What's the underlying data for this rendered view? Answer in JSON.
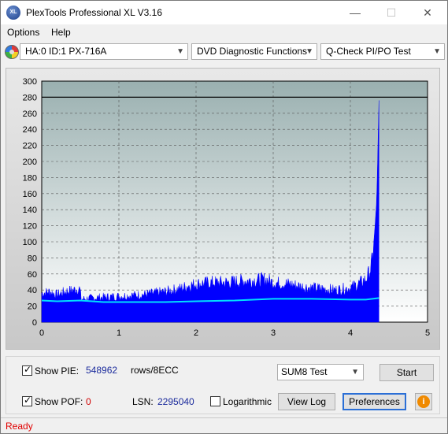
{
  "window": {
    "title": "PlexTools Professional XL V3.16",
    "icon_text": "XL"
  },
  "titlebar_buttons": {
    "minimize": "—",
    "maximize": "☐",
    "close": "✕"
  },
  "menu": [
    {
      "label": "Options"
    },
    {
      "label": "Help"
    }
  ],
  "toolbar": {
    "drive": "HA:0 ID:1  PX-716A",
    "function": "DVD Diagnostic Functions",
    "test": "Q-Check PI/PO Test"
  },
  "controls": {
    "show_pie": {
      "label": "Show PIE:",
      "checked": true,
      "value": "548962",
      "unit": "rows/8ECC"
    },
    "show_pof": {
      "label": "Show POF:",
      "checked": true,
      "value": "0"
    },
    "lsn": {
      "label": "LSN:",
      "value": "2295040"
    },
    "logarithmic": {
      "label": "Logarithmic",
      "checked": false
    },
    "test_select": "SUM8 Test",
    "start_button": "Start",
    "view_log_button": "View Log",
    "preferences_button": "Preferences",
    "info_icon": "i"
  },
  "status": {
    "text": "Ready"
  },
  "chart_data": {
    "type": "area",
    "x_ticks": [
      0,
      1,
      2,
      3,
      4,
      5
    ],
    "y_ticks": [
      0,
      20,
      40,
      60,
      80,
      100,
      120,
      140,
      160,
      180,
      200,
      220,
      240,
      260,
      280,
      300
    ],
    "xlim": [
      0,
      5
    ],
    "ylim": [
      0,
      300
    ],
    "threshold": 280,
    "grid": true,
    "colors": {
      "pie": "#0000ff",
      "sum": "#00e0ff",
      "plot_bg_top": "#9ab0b0",
      "plot_bg_bottom": "#ffffff"
    },
    "pie_series": {
      "x": [
        0,
        0.1,
        0.2,
        0.3,
        0.4,
        0.49,
        0.5,
        0.51,
        0.7,
        1.0,
        1.3,
        1.6,
        1.8,
        1.9,
        2.0,
        2.2,
        2.4,
        2.6,
        2.8,
        2.9,
        3.0,
        3.2,
        3.4,
        3.6,
        3.8,
        4.0,
        4.1,
        4.2,
        4.25,
        4.28,
        4.3,
        4.32,
        4.34,
        4.35,
        4.36,
        4.37
      ],
      "y": [
        38,
        40,
        36,
        40,
        42,
        44,
        40,
        30,
        32,
        34,
        36,
        40,
        44,
        48,
        50,
        52,
        52,
        54,
        55,
        56,
        52,
        50,
        46,
        44,
        42,
        45,
        50,
        56,
        66,
        78,
        96,
        120,
        150,
        185,
        230,
        276
      ]
    },
    "sum_series": {
      "x": [
        0,
        0.2,
        0.5,
        0.8,
        1.2,
        1.6,
        2.0,
        2.5,
        3.0,
        3.5,
        4.0,
        4.2,
        4.37
      ],
      "y": [
        27,
        26,
        27,
        25,
        25,
        25,
        26,
        27,
        29,
        29,
        28,
        28,
        30
      ]
    },
    "x_end": 4.37
  }
}
